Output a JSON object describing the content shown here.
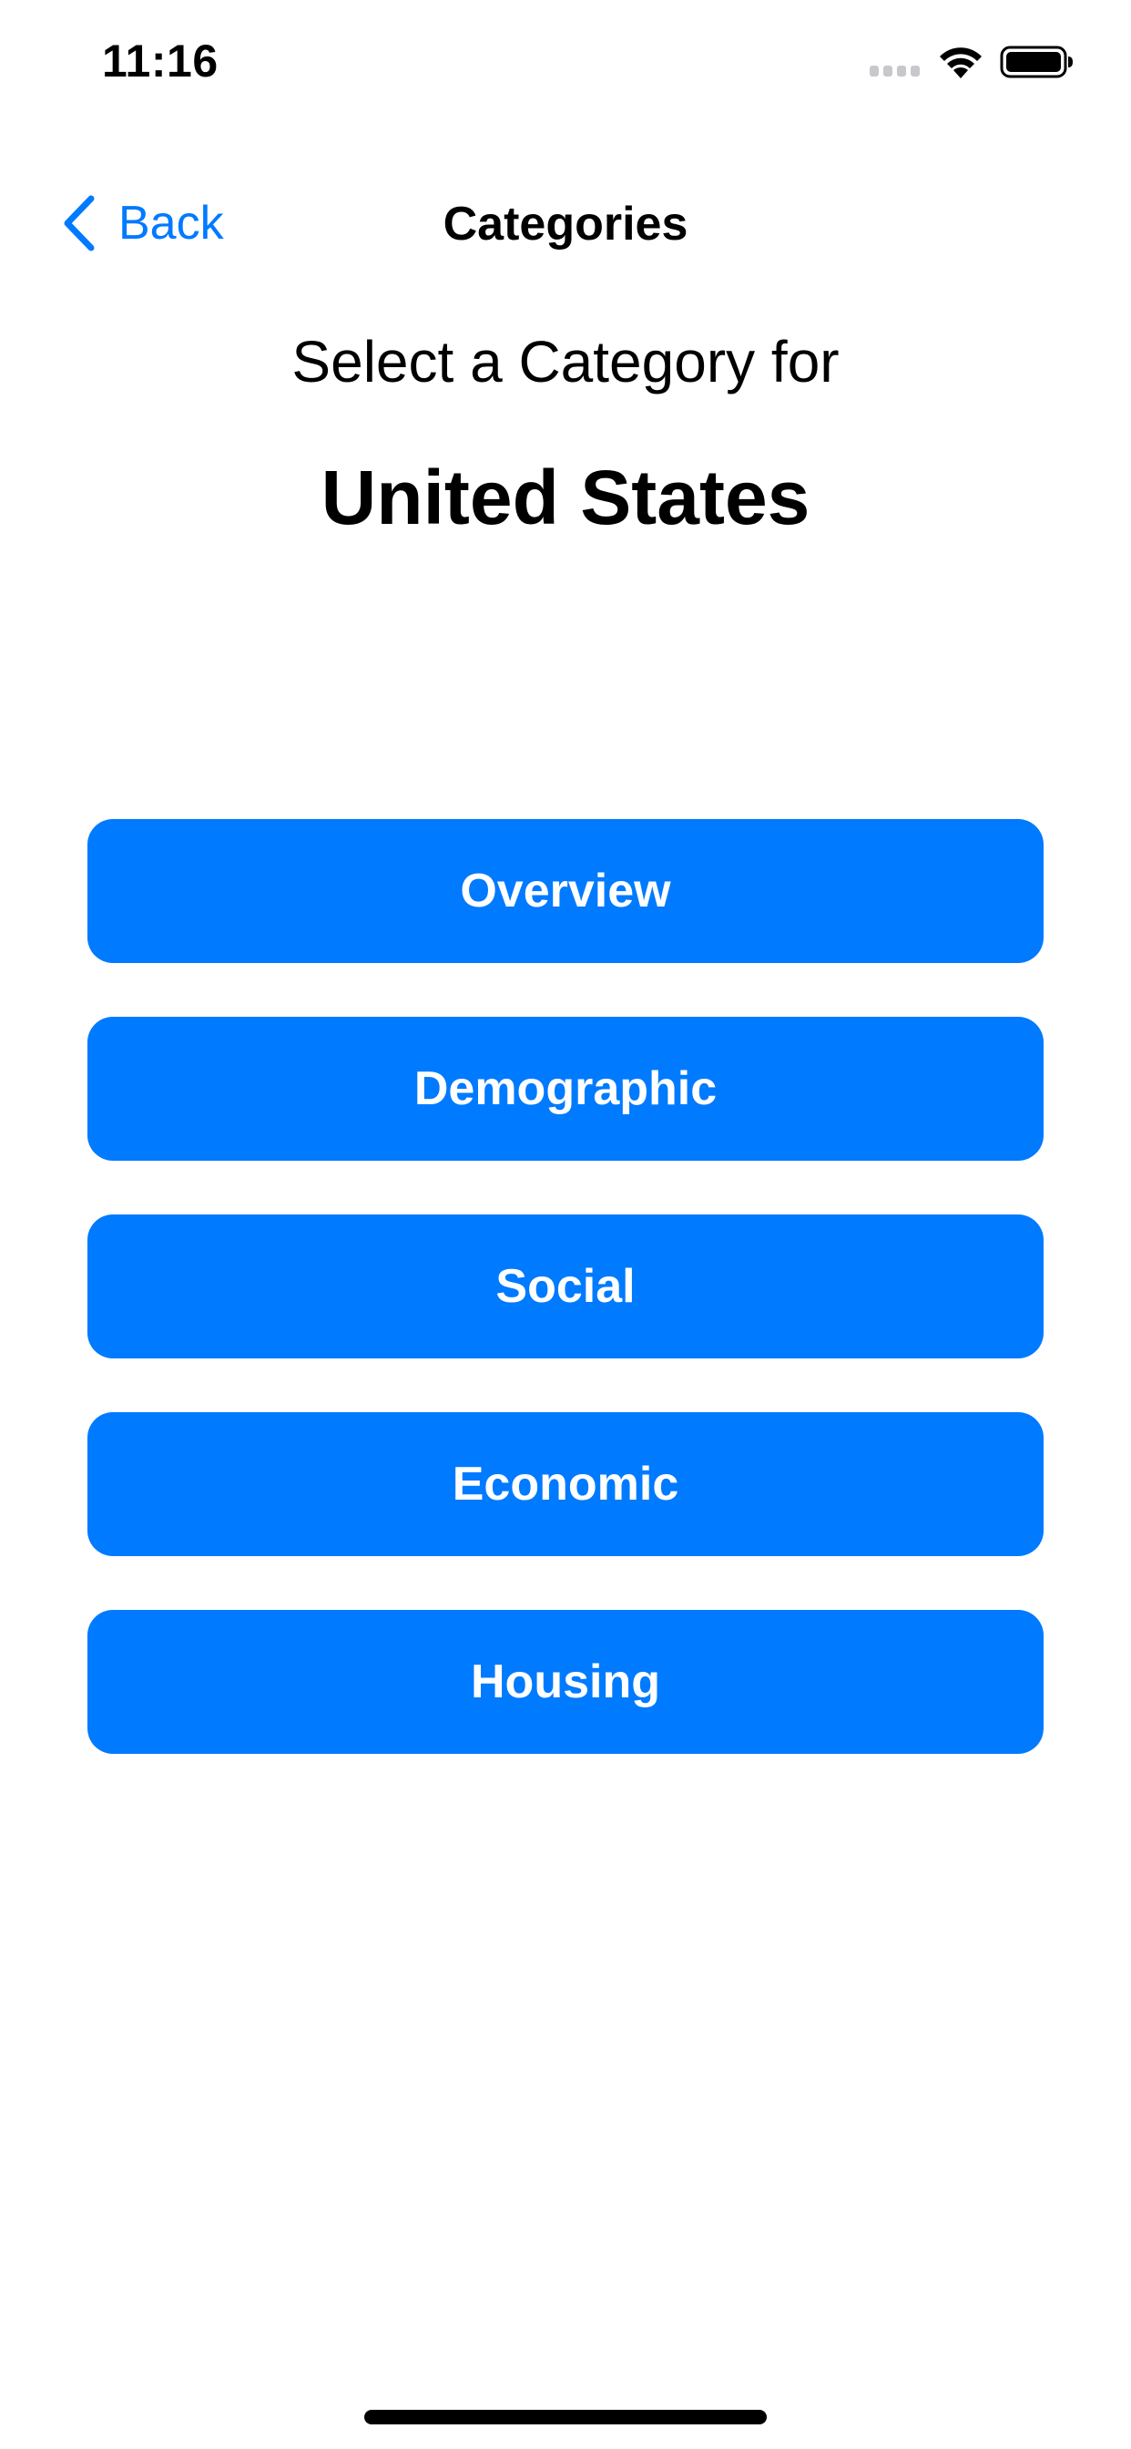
{
  "status_bar": {
    "time": "11:16"
  },
  "nav": {
    "back_label": "Back",
    "title": "Categories"
  },
  "heading": {
    "subtitle": "Select a Category for",
    "country": "United States"
  },
  "categories": [
    {
      "label": "Overview"
    },
    {
      "label": "Demographic"
    },
    {
      "label": "Social"
    },
    {
      "label": "Economic"
    },
    {
      "label": "Housing"
    }
  ],
  "icons": {
    "back": "chevron-left-icon",
    "signal": "signal-icon",
    "wifi": "wifi-icon",
    "battery": "battery-icon"
  },
  "colors": {
    "accent": "#007aff",
    "button_text": "#ffffff",
    "background": "#ffffff",
    "text": "#000000"
  }
}
